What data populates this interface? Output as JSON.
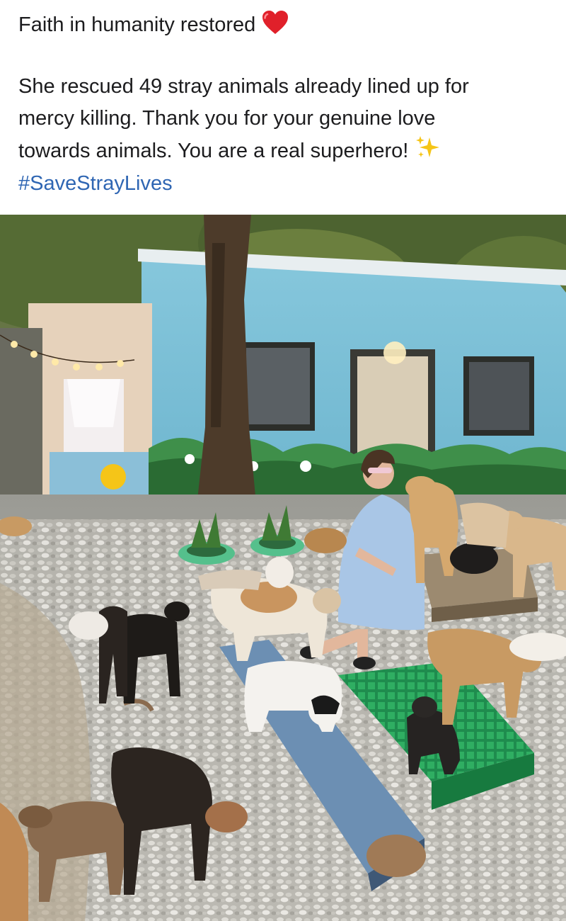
{
  "post": {
    "headline": "Faith in humanity restored",
    "headline_emoji": "red-heart",
    "body_lines": [
      "She rescued 49 stray animals already lined up for",
      "mercy killing. Thank you for your genuine love",
      "towards animals. You are a real superhero!"
    ],
    "body_emoji": "sparkles",
    "hashtag": "#SaveStrayLives",
    "colors": {
      "text": "#1c1c1e",
      "hashtag": "#2f66b3",
      "heart": "#e0202a",
      "sparkles": "#f5c518"
    }
  },
  "photo": {
    "subject": "woman in a light blue dress seated among many rescued dogs in an animal shelter yard",
    "mural_colors": [
      "#7ec3d9",
      "#3f8f4a",
      "#2a6b33"
    ]
  }
}
